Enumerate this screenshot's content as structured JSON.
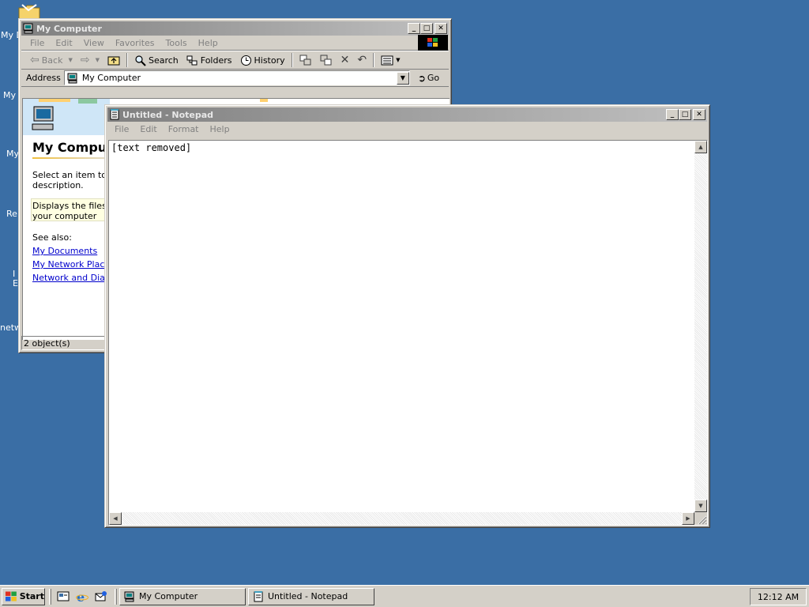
{
  "desktop": {
    "icon_labels": [
      "My D",
      "My",
      "My",
      "Re",
      "I",
      "E",
      "netw"
    ]
  },
  "my_computer": {
    "title": "My Computer",
    "menu": [
      "File",
      "Edit",
      "View",
      "Favorites",
      "Tools",
      "Help"
    ],
    "toolbar": {
      "back": "Back",
      "search": "Search",
      "folders": "Folders",
      "history": "History"
    },
    "address": {
      "label": "Address",
      "value": "My Computer",
      "go": "Go"
    },
    "content": {
      "heading": "My Comput",
      "select_text_1": "Select an item to vi",
      "select_text_2": "description.",
      "displays_text_1": "Displays the files ar",
      "displays_text_2": "your computer",
      "see_also": "See also:",
      "links": [
        "My Documents",
        "My Network Places",
        "Network and Dial-u"
      ]
    },
    "status": "2 object(s)"
  },
  "notepad": {
    "title": "Untitled - Notepad",
    "menu": [
      "File",
      "Edit",
      "Format",
      "Help"
    ],
    "text": "[text removed]"
  },
  "taskbar": {
    "start_label": "Start",
    "tasks": [
      "My Computer",
      "Untitled - Notepad"
    ],
    "clock": "12:12 AM"
  },
  "colors": {
    "desktop": "#3a6ea5",
    "face": "#d4d0c8",
    "inactive_title": "#808080",
    "link": "#0000cc"
  }
}
